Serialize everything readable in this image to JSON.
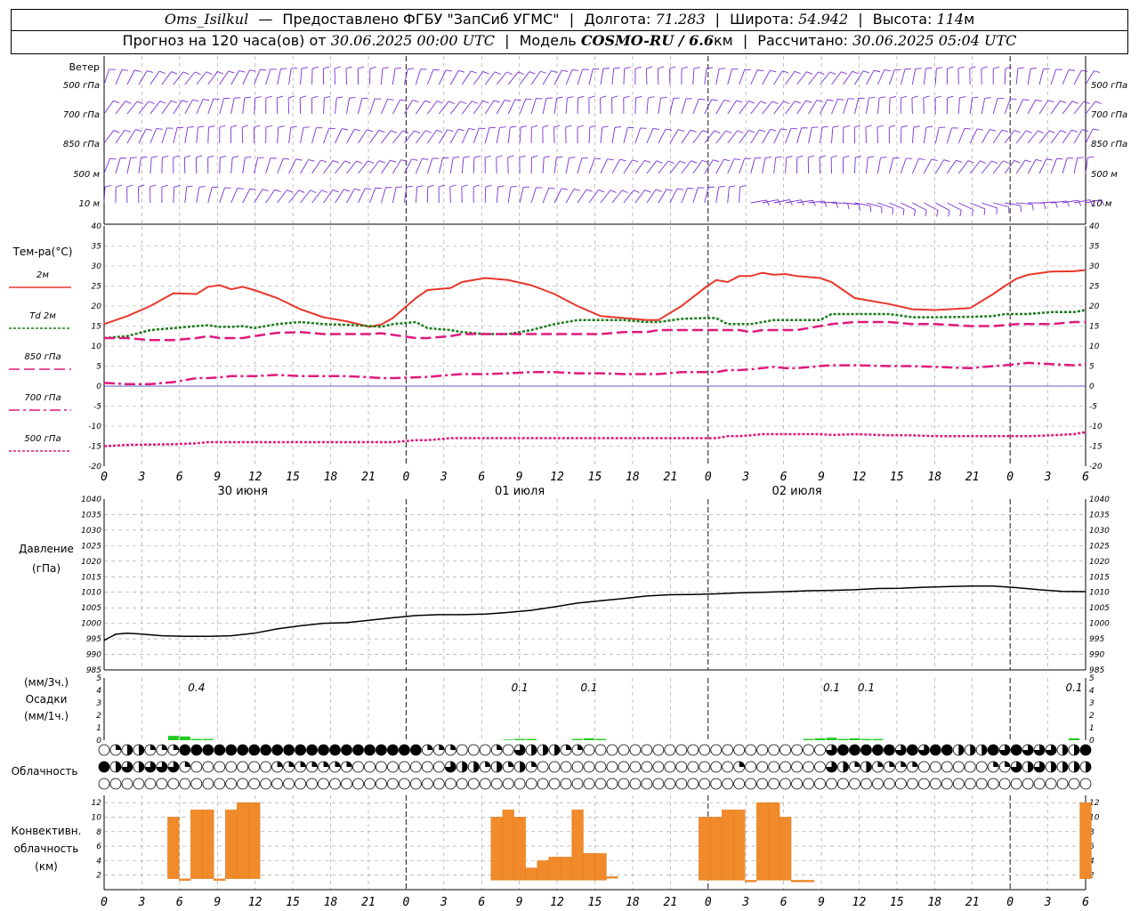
{
  "header": {
    "station": "Oms_Isilkul",
    "dash": "—",
    "provider": "Предоставлено ФГБУ \"ЗапСиб УГМС\"",
    "lon_label": "Долгота:",
    "lon_value": "71.283",
    "lat_label": "Широта:",
    "lat_value": "54.942",
    "alt_label": "Высота:",
    "alt_value": "114",
    "alt_unit": "м",
    "forecast_prefix": "Прогноз на 120 часа(ов) от",
    "forecast_start": "30.06.2025 00:00 UTC",
    "model_label": "Модель",
    "model_value": "COSMO-RU / 6.6",
    "model_unit": "км",
    "calc_label": "Рассчитано:",
    "calc_value": "30.06.2025 05:04 UTC"
  },
  "colors": {
    "t2m": "#e8372a",
    "td2m": "#1a7a1a",
    "t850": "#e0197d",
    "t700": "#e0197d",
    "t500": "#e0197d",
    "wind": "#7b2fd6",
    "pressure": "#000000",
    "precip": "#22cc22",
    "convective": "#f08a2a",
    "zero_line": "#3030c0"
  },
  "time_axis": {
    "tick_labels": [
      "0",
      "3",
      "6",
      "9",
      "12",
      "15",
      "18",
      "21",
      "0",
      "3",
      "6",
      "9",
      "12",
      "15",
      "18",
      "21",
      "0",
      "3",
      "6",
      "9",
      "12",
      "15",
      "18",
      "21",
      "0",
      "3",
      "6"
    ],
    "day_labels": [
      "30 июня",
      "01 июля",
      "02 июля"
    ]
  },
  "wind_panel": {
    "title": "Ветер",
    "levels": [
      "500 гПа",
      "700 гПа",
      "850 гПа",
      "500 м",
      "10 м"
    ],
    "levels_right": [
      "500 гПа",
      "700 гПа",
      "850 гПа",
      "500 м",
      "10 м"
    ]
  },
  "temperature_panel": {
    "title": "Тем-ра(°C)",
    "legend": [
      "2м",
      "Td 2м",
      "850 гПа",
      "700 гПа",
      "500 гПа"
    ],
    "y_ticks": [
      "40",
      "35",
      "30",
      "25",
      "20",
      "15",
      "10",
      "5",
      "0",
      "-5",
      "-10",
      "-15",
      "-20"
    ]
  },
  "pressure_panel": {
    "title": "Давление",
    "unit": "(гПа)",
    "y_ticks": [
      "1040",
      "1035",
      "1030",
      "1025",
      "1020",
      "1015",
      "1010",
      "1005",
      "1000",
      "995",
      "990",
      "985"
    ]
  },
  "precip_panel": {
    "label_3h": "(мм/3ч.)",
    "title": "Осадки",
    "label_1h": "(мм/1ч.)",
    "y_ticks": [
      "5",
      "4",
      "3",
      "2",
      "1",
      "0"
    ],
    "totals": [
      {
        "hour": 8,
        "text": "0.4"
      },
      {
        "hour": 36,
        "text": "0.1"
      },
      {
        "hour": 42,
        "text": "0.1"
      },
      {
        "hour": 63,
        "text": "0.1"
      },
      {
        "hour": 66,
        "text": "0.1"
      },
      {
        "hour": 84,
        "text": "0.1"
      }
    ]
  },
  "cloud_panel": {
    "title": "Облачность"
  },
  "convective_panel": {
    "title_line1": "Конвективн.",
    "title_line2": "облачность",
    "unit": "(км)",
    "y_ticks": [
      "12",
      "10",
      "8",
      "6",
      "4",
      "2"
    ]
  },
  "chart_data": [
    {
      "type": "line",
      "name": "temperature",
      "ylim": [
        -20,
        40
      ],
      "x_hours": [
        0,
        2,
        4,
        6,
        8,
        9,
        10,
        11,
        12,
        13,
        15,
        17,
        19,
        21,
        23,
        24,
        25,
        27,
        28,
        30,
        31,
        33,
        35,
        37,
        39,
        41,
        43,
        45,
        47,
        48,
        50,
        52,
        53,
        54,
        55,
        56,
        57,
        58,
        59,
        60,
        62,
        63,
        65,
        68,
        70,
        72,
        75,
        77,
        78,
        79,
        80,
        82,
        84,
        85
      ],
      "series": [
        {
          "name": "2м",
          "values": [
            15.5,
            17.5,
            20,
            23.2,
            23,
            24.8,
            25.2,
            24.2,
            24.8,
            24,
            22,
            19.2,
            17.2,
            16.2,
            14.8,
            15.4,
            17,
            22,
            24,
            24.5,
            26,
            27,
            26.5,
            25.2,
            23,
            20,
            17.5,
            17,
            16.5,
            16.5,
            20,
            24.5,
            26.5,
            26,
            27.5,
            27.5,
            28.3,
            27.8,
            28,
            27.5,
            27,
            26,
            22,
            20.5,
            19.2,
            19,
            19.5,
            23,
            25,
            26.8,
            27.8,
            28.6,
            28.7,
            29
          ]
        },
        {
          "name": "Td 2м",
          "values": [
            12,
            12.5,
            14,
            14.5,
            15,
            15.2,
            14.8,
            14.8,
            15,
            14.5,
            15.5,
            16,
            15.5,
            15.3,
            15,
            14.8,
            15.5,
            16,
            14.5,
            14,
            13.5,
            13,
            13,
            14,
            15.5,
            16.5,
            16.5,
            16.5,
            16,
            16,
            16.8,
            17,
            17,
            15.5,
            15.5,
            15.5,
            16,
            16.5,
            16.5,
            16.5,
            16.5,
            18,
            18,
            18,
            17.2,
            17.2,
            17.3,
            17.5,
            18,
            18,
            18,
            18.5,
            18.5,
            19
          ]
        },
        {
          "name": "850 гПа",
          "values": [
            12,
            12,
            11.5,
            11.5,
            12,
            12.5,
            12,
            12,
            12,
            12.5,
            13.3,
            13.5,
            13,
            13,
            13,
            13.2,
            12.8,
            12,
            12,
            12.5,
            13,
            13,
            13,
            13,
            13,
            13,
            13,
            13.5,
            13.5,
            14,
            14,
            14,
            14,
            14,
            14,
            13.5,
            14,
            14,
            14,
            14,
            15,
            15.5,
            16,
            16,
            15.5,
            15.5,
            15,
            15,
            15.2,
            15.5,
            15.5,
            15.5,
            16,
            16
          ]
        },
        {
          "name": "700 гПа",
          "values": [
            0.8,
            0.5,
            0.5,
            1,
            2,
            2,
            2.2,
            2.5,
            2.5,
            2.5,
            2.8,
            2.5,
            2.5,
            2.5,
            2.2,
            2,
            2,
            2.2,
            2.3,
            2.8,
            3,
            3,
            3.2,
            3.5,
            3.5,
            3.2,
            3.2,
            3,
            3,
            3,
            3.5,
            3.5,
            3.5,
            4,
            4,
            4.2,
            4.5,
            4.8,
            4.5,
            4.5,
            5,
            5.2,
            5.2,
            5,
            5,
            4.8,
            4.5,
            5,
            5.2,
            5.5,
            5.8,
            5.5,
            5.2,
            5.5
          ]
        },
        {
          "name": "500 гПа",
          "values": [
            -15,
            -14.7,
            -14.6,
            -14.5,
            -14.3,
            -14,
            -14,
            -14,
            -14,
            -14,
            -14,
            -14,
            -14,
            -14,
            -14,
            -14,
            -14,
            -13.5,
            -13.5,
            -13,
            -13,
            -13,
            -13,
            -13,
            -13,
            -13,
            -13,
            -13,
            -13,
            -13,
            -13,
            -13,
            -13,
            -12.5,
            -12.5,
            -12.3,
            -12,
            -12,
            -12,
            -12,
            -12,
            -12.2,
            -12,
            -12.3,
            -12.3,
            -12.5,
            -12.5,
            -12.5,
            -12.5,
            -12.5,
            -12.5,
            -12.3,
            -12,
            -11.5
          ]
        }
      ]
    },
    {
      "type": "line",
      "name": "pressure",
      "ylim": [
        985,
        1040
      ],
      "x_hours": [
        0,
        1,
        2,
        3,
        5,
        7,
        9,
        11,
        13,
        15,
        17,
        19,
        21,
        23,
        25,
        27,
        29,
        31,
        33,
        35,
        37,
        39,
        41,
        43,
        45,
        47,
        49,
        51,
        53,
        55,
        57,
        59,
        61,
        63,
        65,
        67,
        69,
        71,
        73,
        75,
        77,
        79,
        81,
        83,
        85
      ],
      "values": [
        994.5,
        996.5,
        996.8,
        996.6,
        996,
        995.8,
        995.8,
        996,
        996.8,
        998.2,
        999.2,
        1000,
        1000.2,
        1001,
        1001.8,
        1002.5,
        1002.8,
        1002.8,
        1003,
        1003.5,
        1004.2,
        1005.3,
        1006.5,
        1007.3,
        1008,
        1008.8,
        1009.2,
        1009.3,
        1009.5,
        1009.8,
        1010,
        1010.2,
        1010.5,
        1010.6,
        1010.8,
        1011.2,
        1011.3,
        1011.6,
        1011.8,
        1012,
        1012,
        1011.5,
        1010.8,
        1010.3,
        1010.2
      ]
    },
    {
      "type": "bar",
      "name": "precipitation_1h",
      "ylim": [
        0,
        5
      ],
      "x_hours": [
        6,
        7,
        8,
        9,
        35,
        36,
        37,
        41,
        42,
        43,
        61,
        62,
        63,
        64,
        65,
        66,
        67,
        84
      ],
      "values": [
        0.35,
        0.3,
        0.1,
        0.1,
        0.05,
        0.1,
        0.1,
        0.1,
        0.15,
        0.1,
        0.1,
        0.15,
        0.2,
        0.1,
        0.15,
        0.1,
        0.1,
        0.15
      ]
    },
    {
      "type": "heatmap",
      "name": "cloud_cover_octas",
      "rows": [
        "upper",
        "middle",
        "lower"
      ],
      "x_hours": [
        0,
        1,
        2,
        3,
        4,
        5,
        6,
        7,
        8,
        9,
        10,
        11,
        12,
        13,
        14,
        15,
        16,
        17,
        18,
        19,
        20,
        21,
        22,
        23,
        24,
        25,
        26,
        27,
        28,
        29,
        30,
        31,
        32,
        33,
        34,
        35,
        36,
        37,
        38,
        39,
        40,
        41,
        42,
        43,
        44,
        45,
        46,
        47,
        48,
        49,
        50,
        51,
        52,
        53,
        54,
        55,
        56,
        57,
        58,
        59,
        60,
        61,
        62,
        63,
        64,
        65,
        66,
        67,
        68,
        69,
        70,
        71,
        72,
        73,
        74,
        75,
        76,
        77,
        78,
        79,
        80,
        81,
        82,
        83,
        84,
        85
      ],
      "values": [
        [
          0,
          2,
          4,
          5,
          3,
          3,
          2,
          8,
          8,
          8,
          8,
          8,
          8,
          8,
          8,
          8,
          8,
          8,
          8,
          8,
          8,
          8,
          8,
          8,
          8,
          8,
          8,
          8,
          2,
          2,
          2,
          0,
          0,
          0,
          2,
          0,
          6,
          5,
          4,
          4,
          2,
          2,
          0,
          0,
          0,
          0,
          0,
          0,
          0,
          0,
          0,
          0,
          0,
          0,
          0,
          0,
          0,
          0,
          0,
          0,
          0,
          0,
          0,
          6,
          8,
          8,
          8,
          8,
          8,
          6,
          8,
          7,
          8,
          8,
          4,
          4,
          4,
          8,
          6,
          8,
          6,
          6,
          6,
          4,
          4,
          8
        ],
        [
          8,
          4,
          6,
          4,
          6,
          6,
          6,
          2,
          0,
          0,
          0,
          0,
          0,
          0,
          0,
          2,
          2,
          2,
          2,
          2,
          2,
          2,
          0,
          0,
          0,
          0,
          0,
          0,
          0,
          0,
          6,
          4,
          4,
          2,
          4,
          2,
          4,
          2,
          0,
          0,
          0,
          0,
          0,
          0,
          0,
          0,
          0,
          0,
          0,
          0,
          0,
          0,
          0,
          0,
          0,
          2,
          0,
          0,
          0,
          0,
          0,
          0,
          0,
          6,
          4,
          2,
          4,
          2,
          2,
          2,
          2,
          0,
          0,
          0,
          0,
          0,
          0,
          2,
          2,
          6,
          4,
          6,
          4,
          4,
          4,
          4
        ],
        [
          0,
          0,
          0,
          0,
          0,
          0,
          0,
          0,
          0,
          0,
          0,
          0,
          0,
          0,
          0,
          0,
          0,
          0,
          0,
          0,
          0,
          0,
          0,
          0,
          0,
          0,
          0,
          0,
          0,
          0,
          0,
          0,
          0,
          0,
          0,
          0,
          0,
          0,
          0,
          0,
          0,
          0,
          0,
          0,
          0,
          0,
          0,
          0,
          0,
          0,
          0,
          0,
          0,
          0,
          0,
          0,
          0,
          0,
          0,
          0,
          0,
          0,
          0,
          0,
          0,
          0,
          0,
          0,
          0,
          0,
          0,
          0,
          0,
          0,
          0,
          0,
          0,
          0,
          0,
          0,
          0,
          0,
          0,
          0,
          0,
          0
        ]
      ]
    },
    {
      "type": "bar",
      "name": "convective_cloud_km",
      "ylim": [
        0,
        13
      ],
      "x_hours": [
        6,
        7,
        8,
        9,
        10,
        11,
        12,
        13,
        34,
        35,
        36,
        37,
        38,
        39,
        40,
        41,
        42,
        43,
        44,
        52,
        53,
        54,
        55,
        56,
        57,
        58,
        59,
        60,
        61,
        85
      ],
      "bottoms": [
        1.5,
        1.5,
        1.5,
        1.5,
        1.5,
        1.5,
        1.5,
        1.5,
        1.3,
        1.3,
        1.3,
        1.3,
        1.3,
        1.3,
        1.3,
        1.3,
        1.3,
        1.3,
        1.6,
        1.3,
        1.3,
        1.3,
        1.3,
        1.3,
        1.3,
        1.3,
        1.3,
        1.3,
        1.3,
        1.5
      ],
      "tops": [
        10,
        1.5,
        11,
        11,
        1.5,
        11,
        12,
        12,
        10,
        11,
        10,
        3,
        4,
        4.5,
        4.5,
        11,
        5,
        5,
        1.8,
        10,
        10,
        11,
        11,
        1.3,
        12,
        12,
        10,
        1.3,
        1.3,
        12
      ]
    }
  ]
}
